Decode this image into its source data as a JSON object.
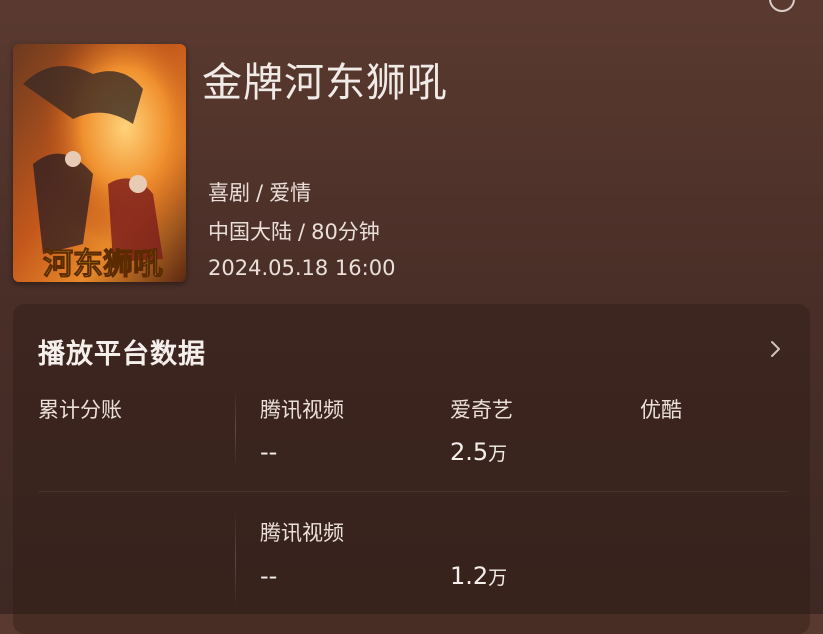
{
  "movie": {
    "title": "金牌河东狮吼",
    "genres": [
      "喜剧",
      "爱情"
    ],
    "region": "中国大陆",
    "duration": "80分钟",
    "release": "2024.05.18 16:00",
    "poster_text": "河东狮吼"
  },
  "platform_card": {
    "title": "播放平台数据",
    "row_label": "累计分账",
    "row1": [
      {
        "platform": "腾讯视频",
        "value": "--",
        "unit": ""
      },
      {
        "platform": "爱奇艺",
        "value": "2.5",
        "unit": "万"
      },
      {
        "platform": "优酷",
        "value": "",
        "unit": ""
      }
    ],
    "row2": [
      {
        "platform": "腾讯视频",
        "value": "--",
        "unit": ""
      },
      {
        "platform": "",
        "value": "1.2",
        "unit": "万"
      }
    ]
  },
  "icons": {
    "chevron": "chevron-right-icon"
  },
  "colors": {
    "background": "#4a2f28",
    "text": "#f2e9e4"
  }
}
